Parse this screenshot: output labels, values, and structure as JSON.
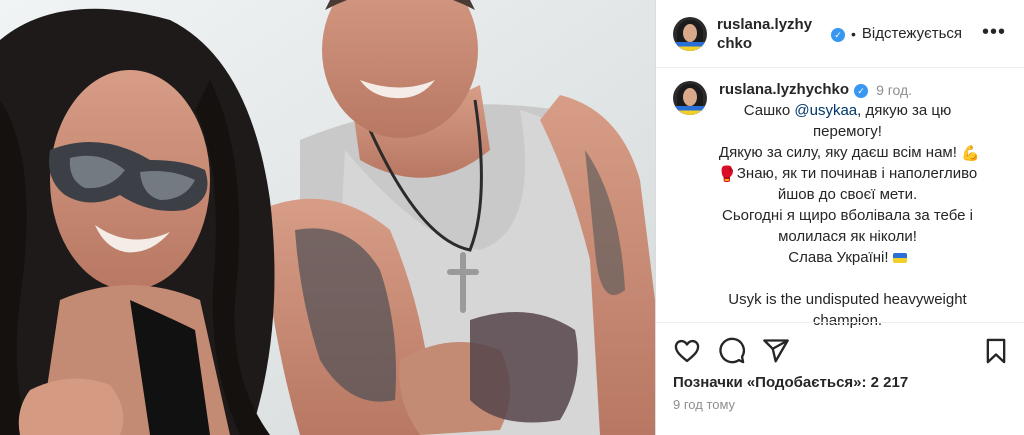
{
  "photo": {
    "description_icon": "photo-of-two-people"
  },
  "header": {
    "username": "ruslana.lyzhychko",
    "username_line1": "ruslana.lyzhy",
    "username_line2": "chko",
    "dot": "•",
    "follow_status": "Відстежується",
    "more_icon": "more-icon",
    "more_glyph": "•••"
  },
  "caption": {
    "username": "ruslana.lyzhychko",
    "time": "9 год.",
    "line1_a": "Сашко ",
    "mention": "@usykaa",
    "line1_b": ", дякую за цю",
    "line2": "перемогу!",
    "line3": "Дякую за силу, яку даєш всім нам!",
    "line4": "Знаю, як ти починав і наполегливо",
    "line5": "йшов до своєї мети.",
    "line6": "Сьогодні я щиро вболівала за тебе і",
    "line7": "молилася як ніколи!",
    "line8": "Слава Україні!",
    "line9": "Usyk is the undisputed heavyweight",
    "line10": "champion."
  },
  "footer": {
    "likes": "Позначки «Подобається»: 2 217",
    "ago": "9 год тому"
  },
  "colors": {
    "verified": "#3897f0",
    "mention": "#00376b",
    "muted": "#8e8e8e"
  }
}
